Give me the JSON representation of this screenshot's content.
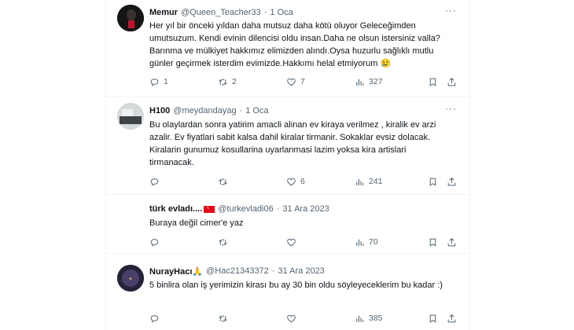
{
  "tweets": [
    {
      "name": "Memur",
      "handle": "@Queen_Teacher33",
      "dot": "·",
      "date": "1 Oca",
      "text": "Her yıl bir önceki yıldan daha mutsuz daha kötü oluyor Geleceğimden umutsuzum. Kendi evinin dilencisi oldu insan.Daha ne olsun istersiniz valla? Barınma ve mülkiyet hakkımız elimizden alındı.Oysa huzurlu sağlıklı mutlu günler geçirmek isterdim evimizde.Hakkımı helal etmiyorum",
      "emoji": "😢",
      "replies": "1",
      "retweets": "2",
      "likes": "7",
      "views": "327"
    },
    {
      "name": "H100",
      "handle": "@meydandayag",
      "dot": "·",
      "date": "1 Oca",
      "text": "Bu olaylardan sonra yatirim amacli alinan ev kiraya verilmez  , kiralik ev arzi azalir. Ev fiyatlari sabit kalsa dahil kiralar tirmanir. Sokaklar evsiz dolacak. Kiralarin gunumuz kosullarina uyarlanmasi lazim yoksa kira artislari tirmanacak.",
      "replies": "",
      "retweets": "",
      "likes": "6",
      "views": "241"
    },
    {
      "name": "türk evladı....",
      "handle": "@turkevladi06",
      "dot": "·",
      "date": "31 Ara 2023",
      "text": "Buraya değil cimer'e yaz",
      "replies": "",
      "retweets": "",
      "likes": "",
      "views": "70"
    },
    {
      "name": "NurayHacı",
      "name_emoji": "🙏",
      "handle": "@Hac21343372",
      "dot": "·",
      "date": "31 Ara 2023",
      "text": "5 binlira olan iş yerimizin kirası bu ay 30 bin oldu söyleyeceklerim bu kadar :)",
      "replies": "",
      "retweets": "",
      "likes": "",
      "views": "385"
    }
  ],
  "more_label": "···",
  "icons": [
    "reply-icon",
    "retweet-icon",
    "like-icon",
    "views-icon",
    "bookmark-icon",
    "share-icon"
  ]
}
